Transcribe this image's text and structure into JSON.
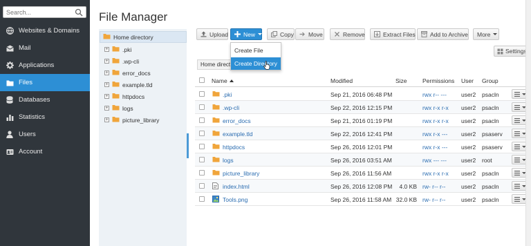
{
  "sidebar": {
    "search_placeholder": "Search...",
    "items": [
      {
        "label": "Websites & Domains",
        "icon": "globe-icon"
      },
      {
        "label": "Mail",
        "icon": "mail-icon"
      },
      {
        "label": "Applications",
        "icon": "gear-icon"
      },
      {
        "label": "Files",
        "icon": "folder-icon",
        "active": true
      },
      {
        "label": "Databases",
        "icon": "database-icon"
      },
      {
        "label": "Statistics",
        "icon": "bar-chart-icon"
      },
      {
        "label": "Users",
        "icon": "user-icon"
      },
      {
        "label": "Account",
        "icon": "account-icon"
      }
    ]
  },
  "page": {
    "title": "File Manager"
  },
  "tree": {
    "home": "Home directory",
    "items": [
      ".pki",
      ".wp-cli",
      "error_docs",
      "example.tld",
      "httpdocs",
      "logs",
      "picture_library"
    ]
  },
  "toolbar": {
    "upload": "Upload",
    "new": "New",
    "copy": "Copy",
    "move": "Move",
    "remove": "Remove",
    "extract": "Extract Files",
    "archive": "Add to Archive",
    "more": "More",
    "settings": "Settings"
  },
  "dropdown": {
    "items": [
      "Create File",
      "Create Directory"
    ]
  },
  "breadcrumb": "Home directory",
  "table": {
    "headers": {
      "name": "Name",
      "modified": "Modified",
      "size": "Size",
      "permissions": "Permissions",
      "user": "User",
      "group": "Group"
    },
    "rows": [
      {
        "name": ".pki",
        "type": "folder",
        "modified": "Sep 21, 2016 06:48 PM",
        "size": "",
        "perm": "rwx r-- ---",
        "user": "user2",
        "group": "psacln"
      },
      {
        "name": ".wp-cli",
        "type": "folder",
        "modified": "Sep 22, 2016 12:15 PM",
        "size": "",
        "perm": "rwx r-x r-x",
        "user": "user2",
        "group": "psacln"
      },
      {
        "name": "error_docs",
        "type": "folder",
        "modified": "Sep 21, 2016 01:19 PM",
        "size": "",
        "perm": "rwx r-x r-x",
        "user": "user2",
        "group": "psacln"
      },
      {
        "name": "example.tld",
        "type": "folder",
        "modified": "Sep 22, 2016 12:41 PM",
        "size": "",
        "perm": "rwx r-x ---",
        "user": "user2",
        "group": "psaserv"
      },
      {
        "name": "httpdocs",
        "type": "folder",
        "modified": "Sep 26, 2016 12:01 PM",
        "size": "",
        "perm": "rwx r-x ---",
        "user": "user2",
        "group": "psaserv"
      },
      {
        "name": "logs",
        "type": "folder",
        "modified": "Sep 26, 2016 03:51 AM",
        "size": "",
        "perm": "rwx --- ---",
        "user": "user2",
        "group": "root"
      },
      {
        "name": "picture_library",
        "type": "folder",
        "modified": "Sep 26, 2016 11:56 AM",
        "size": "",
        "perm": "rwx r-x r-x",
        "user": "user2",
        "group": "psacln"
      },
      {
        "name": "index.html",
        "type": "html",
        "modified": "Sep 26, 2016 12:08 PM",
        "size": "4.0 KB",
        "perm": "rw- r-- r--",
        "user": "user2",
        "group": "psacln"
      },
      {
        "name": "Tools.png",
        "type": "image",
        "modified": "Sep 26, 2016 11:58 AM",
        "size": "32.0 KB",
        "perm": "rw- r-- r--",
        "user": "user2",
        "group": "psacln"
      }
    ]
  },
  "colors": {
    "sidebar_bg": "#30363c",
    "accent": "#2d8fd5",
    "folder": "#f0a53b",
    "link": "#2a6cb0"
  }
}
